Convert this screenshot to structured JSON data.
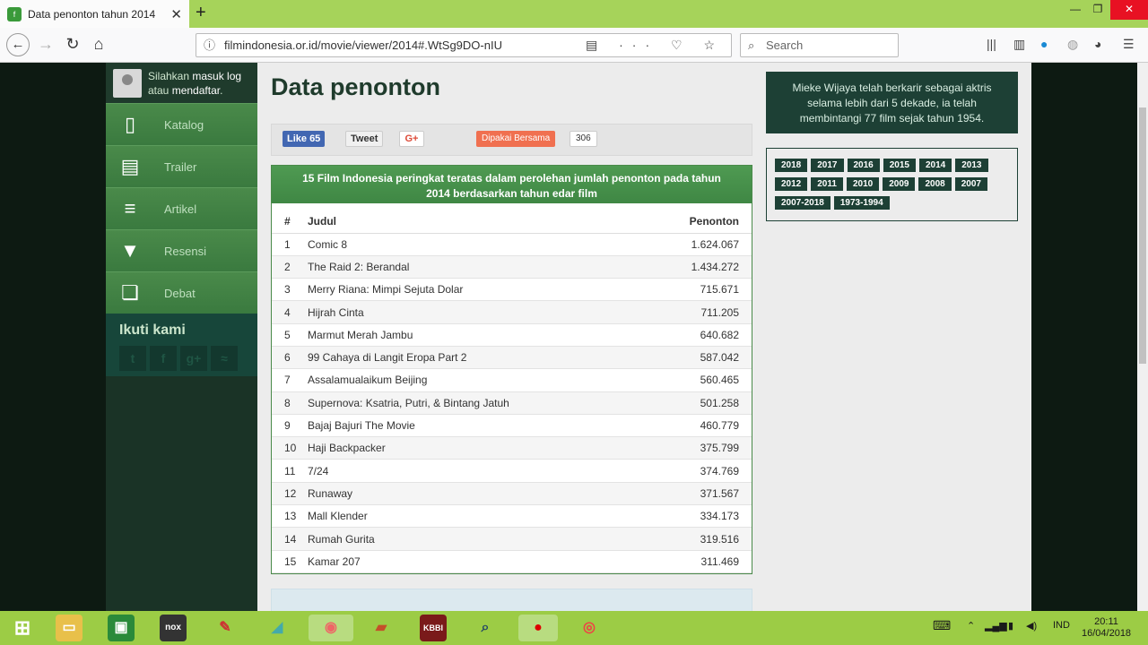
{
  "browser": {
    "tab_title": "Data penonton tahun 2014",
    "url": "filmindonesia.or.id/movie/viewer/2014#.WtSg9DO-nIU",
    "search_placeholder": "Search"
  },
  "sidebar": {
    "user_line1_prefix": "Silahkan",
    "user_login": "masuk log",
    "user_line2_prefix": "atau",
    "user_register": "mendaftar",
    "menu": [
      {
        "label": "Katalog",
        "icon": "book-icon"
      },
      {
        "label": "Trailer",
        "icon": "clapperboard-icon"
      },
      {
        "label": "Artikel",
        "icon": "article-icon"
      },
      {
        "label": "Resensi",
        "icon": "bookmark-icon"
      },
      {
        "label": "Debat",
        "icon": "chat-icon"
      }
    ],
    "follow_title": "Ikuti kami",
    "socials": [
      "twitter-icon",
      "facebook-icon",
      "googleplus-icon",
      "rss-icon"
    ]
  },
  "main": {
    "title": "Data penonton",
    "share": {
      "like_label": "Like 65",
      "tweet_label": "Tweet",
      "gplus_label": "G+",
      "dipakai_label": "Dipakai Bersama",
      "dipakai_count": "306"
    },
    "table_heading": "15 Film Indonesia peringkat teratas dalam perolehan jumlah penonton pada tahun 2014 berdasarkan tahun edar film",
    "columns": [
      "#",
      "Judul",
      "Penonton"
    ],
    "rows": [
      {
        "no": "1",
        "title": "Comic 8",
        "viewers": "1.624.067"
      },
      {
        "no": "2",
        "title": "The Raid 2: Berandal",
        "viewers": "1.434.272"
      },
      {
        "no": "3",
        "title": "Merry Riana: Mimpi Sejuta Dolar",
        "viewers": "715.671"
      },
      {
        "no": "4",
        "title": "Hijrah Cinta",
        "viewers": "711.205"
      },
      {
        "no": "5",
        "title": "Marmut Merah Jambu",
        "viewers": "640.682"
      },
      {
        "no": "6",
        "title": "99 Cahaya di Langit Eropa Part 2",
        "viewers": "587.042"
      },
      {
        "no": "7",
        "title": "Assalamualaikum Beijing",
        "viewers": "560.465"
      },
      {
        "no": "8",
        "title": "Supernova: Ksatria, Putri, & Bintang Jatuh",
        "viewers": "501.258"
      },
      {
        "no": "9",
        "title": "Bajaj Bajuri The Movie",
        "viewers": "460.779"
      },
      {
        "no": "10",
        "title": "Haji Backpacker",
        "viewers": "375.799"
      },
      {
        "no": "11",
        "title": "7/24",
        "viewers": "374.769"
      },
      {
        "no": "12",
        "title": "Runaway",
        "viewers": "371.567"
      },
      {
        "no": "13",
        "title": "Mall Klender",
        "viewers": "334.173"
      },
      {
        "no": "14",
        "title": "Rumah Gurita",
        "viewers": "319.516"
      },
      {
        "no": "15",
        "title": "Kamar 207",
        "viewers": "311.469"
      }
    ]
  },
  "right": {
    "info_text": "Mieke Wijaya telah berkarir sebagai aktris selama lebih dari 5 dekade, ia telah membintangi 77 film sejak tahun 1954.",
    "years": [
      "2018",
      "2017",
      "2016",
      "2015",
      "2014",
      "2013",
      "2012",
      "2011",
      "2010",
      "2009",
      "2008",
      "2007",
      "2007-2018",
      "1973-1994"
    ]
  },
  "taskbar": {
    "lang": "IND",
    "time": "20:11",
    "date": "16/04/2018"
  },
  "colors": {
    "chrome_green": "#a6d35a",
    "sidebar_dark": "#1a3326",
    "accent_green": "#4a8a4a",
    "dark_teal": "#1d4035"
  }
}
